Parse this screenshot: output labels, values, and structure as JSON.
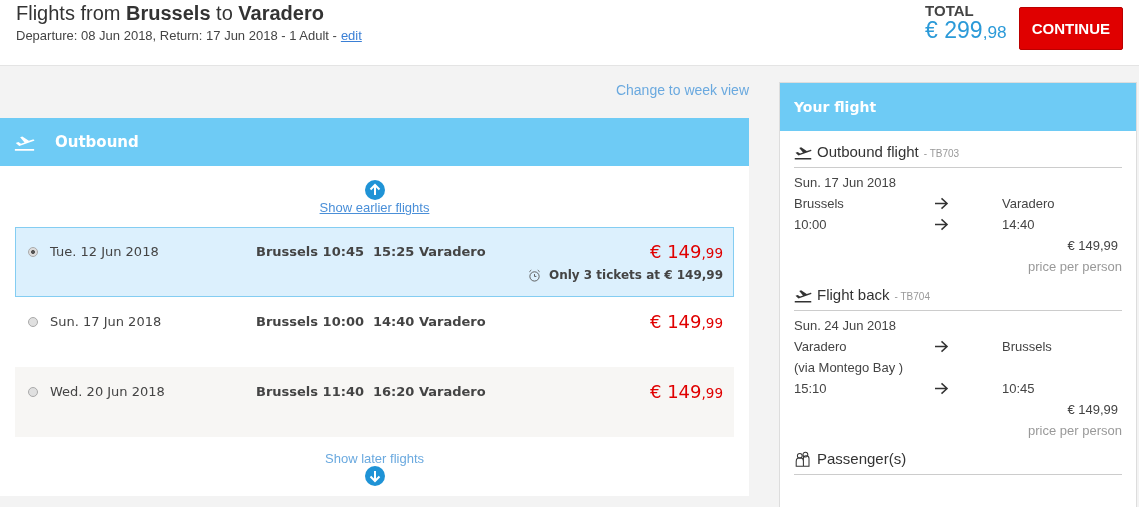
{
  "header": {
    "title": "Flights from **Brussels** to **Varadero**",
    "subtitle": "Departure: 08 Jun 2018, Return: 17 Jun 2018 - 1 Adult -",
    "edit_link": "edit",
    "total_label": "TOTAL",
    "total_main": "€ 299",
    "total_cents": ",98",
    "continue_button": "CONTINUE"
  },
  "week_view_link": "Change to week view",
  "outbound": {
    "title": "Outbound",
    "earlier_link": "Show earlier flights",
    "later_link": "Show later flights",
    "flights": [
      {
        "date": "Tue. 12 Jun 2018",
        "departure": "Brussels 10:45",
        "arrival": "15:25 Varadero",
        "price_main": "€ 149",
        "price_cents": ",99",
        "notice": "Only 3 tickets at € 149,99",
        "selected": true
      },
      {
        "date": "Sun. 17 Jun 2018",
        "departure": "Brussels 10:00",
        "arrival": "14:40 Varadero",
        "price_main": "€ 149",
        "price_cents": ",99",
        "selected": false
      },
      {
        "date": "Wed. 20 Jun 2018",
        "departure": "Brussels 11:40",
        "arrival": "16:20 Varadero",
        "price_main": "€ 149",
        "price_cents": ",99",
        "selected": false
      }
    ]
  },
  "summary": {
    "title": "Your flight",
    "legs": [
      {
        "title": "Outbound flight",
        "code": "- TB703",
        "date": "Sun. 17 Jun 2018",
        "from": "Brussels",
        "to": "Varadero",
        "dep_time": "10:00",
        "arr_time": "14:40",
        "price": "€ 149,99",
        "price_note": "price per person"
      },
      {
        "title": "Flight back",
        "code": "- TB704",
        "date": "Sun. 24 Jun 2018",
        "from": "Varadero",
        "to": "Brussels",
        "via": "(via Montego Bay )",
        "dep_time": "15:10",
        "arr_time": "10:45",
        "price": "€ 149,99",
        "price_note": "price per person"
      }
    ],
    "passengers_title": "Passenger(s)"
  }
}
